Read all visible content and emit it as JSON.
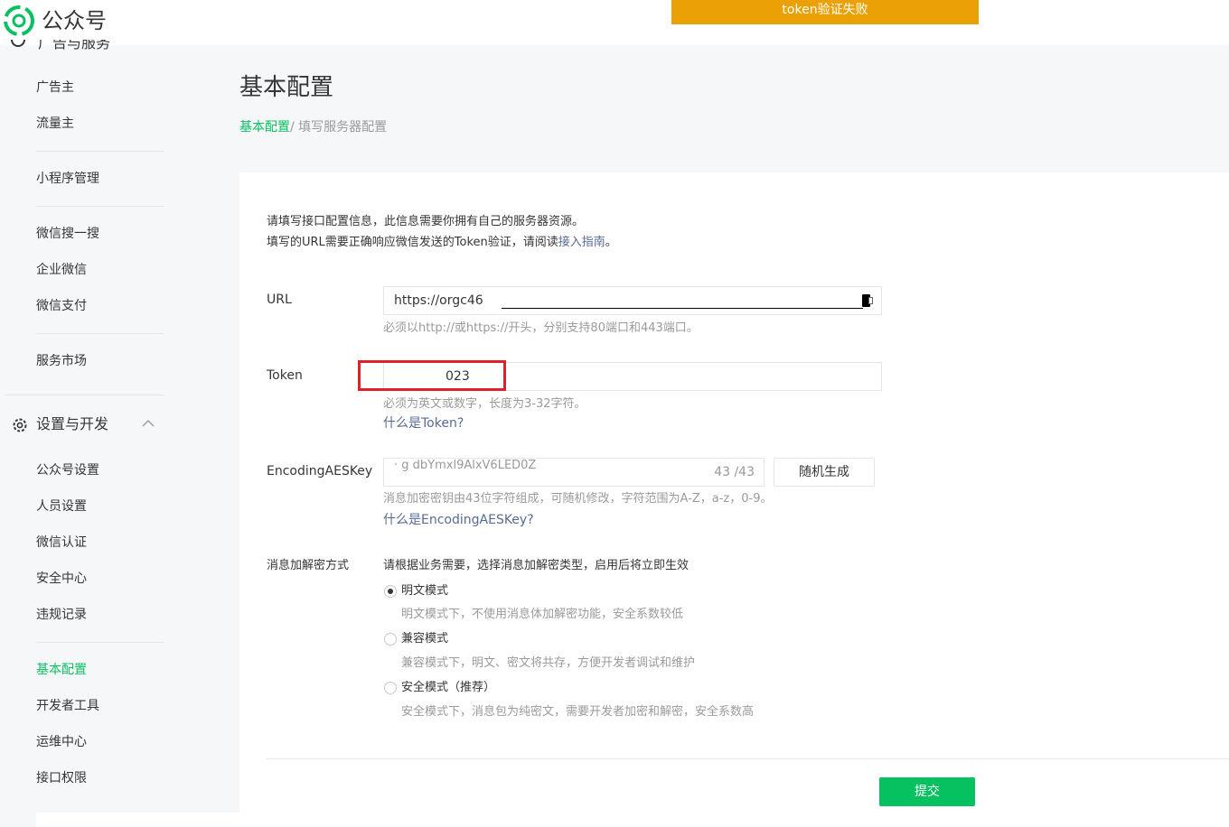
{
  "header": {
    "brand": "公众号",
    "alert": "token验证失败"
  },
  "sidebar": {
    "partial_label": "广告与服务",
    "items_top": [
      "广告主",
      "流量主",
      "小程序管理",
      "微信搜一搜",
      "企业微信",
      "微信支付",
      "服务市场"
    ],
    "group_label": "设置与开发",
    "items_settings": [
      "公众号设置",
      "人员设置",
      "微信认证",
      "安全中心",
      "违规记录"
    ],
    "items_dev": [
      "基本配置",
      "开发者工具",
      "运维中心",
      "接口权限"
    ],
    "active": "基本配置"
  },
  "main": {
    "title": "基本配置",
    "breadcrumb_current": "基本配置",
    "breadcrumb_next": "/ 填写服务器配置",
    "intro_line1": "请填写接口配置信息，此信息需要你拥有自己的服务器资源。",
    "intro_line2_pre": "填写的URL需要正确响应微信发送的Token验证，请阅读",
    "intro_link": "接入指南",
    "intro_line2_post": "。"
  },
  "form": {
    "url_label": "URL",
    "url_value": "https://orgc46",
    "url_tip": "必须以http://或https://开头，分别支持80端口和443端口。",
    "token_label": "Token",
    "token_value": "023",
    "token_tip": "必须为英文或数字，长度为3-32字符。",
    "token_link": "什么是Token?",
    "aes_label": "EncodingAESKey",
    "aes_value": "· g dbYmxl9AlxV6LED0Z",
    "aes_count": "43 /43",
    "aes_generate": "随机生成",
    "aes_tip": "消息加密密钥由43位字符组成，可随机修改，字符范围为A-Z，a-z，0-9。",
    "aes_link": "什么是EncodingAESKey?",
    "enc_label": "消息加解密方式",
    "enc_hint": "请根据业务需要，选择消息加解密类型，启用后将立即生效",
    "modes": [
      {
        "label": "明文模式",
        "desc": "明文模式下，不使用消息体加解密功能，安全系数较低",
        "selected": true
      },
      {
        "label": "兼容模式",
        "desc": "兼容模式下，明文、密文将共存，方便开发者调试和维护",
        "selected": false
      },
      {
        "label": "安全模式（推荐）",
        "desc": "安全模式下，消息包为纯密文，需要开发者加密和解密，安全系数高",
        "selected": false
      }
    ],
    "submit": "提交"
  },
  "colors": {
    "accent": "#07c160",
    "alert_bg": "#eba105",
    "highlight": "#e0202a",
    "link": "#576b95"
  },
  "icons": [
    "wechat-logo-icon",
    "gear-icon",
    "chevron-up-icon",
    "service-icon"
  ]
}
